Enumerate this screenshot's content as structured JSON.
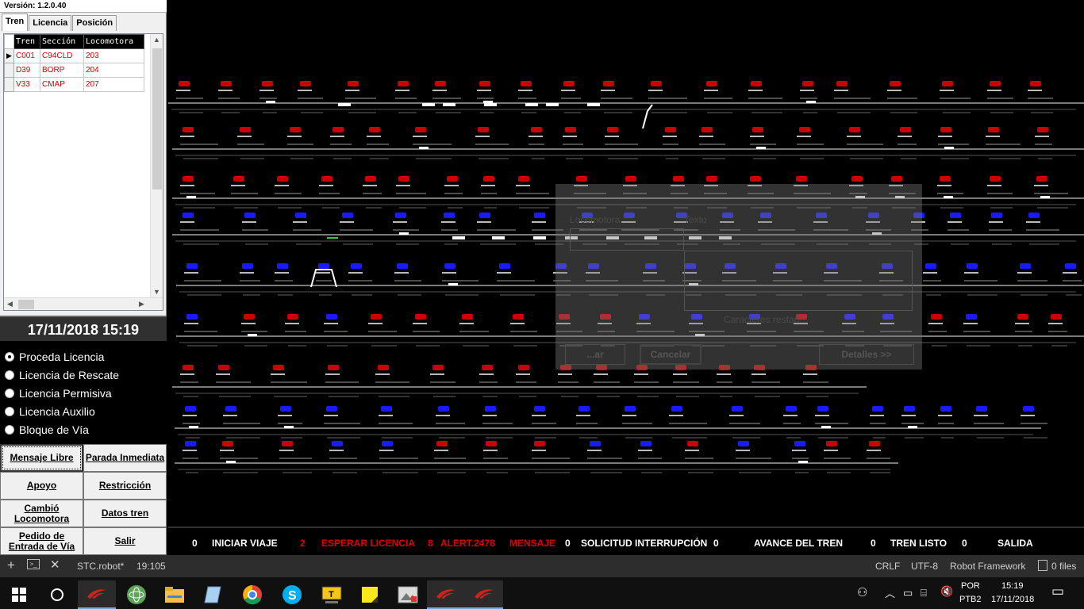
{
  "version": "Versión: 1.2.0.40",
  "tabs": [
    "Tren",
    "Licencia",
    "Posición"
  ],
  "grid": {
    "headers": [
      "Tren",
      "Sección",
      "Locomotora"
    ],
    "rows": [
      [
        "C001",
        "C94CLD",
        "203"
      ],
      [
        "D39",
        "BORP",
        "204"
      ],
      [
        "V33",
        "CMAP",
        "207"
      ]
    ]
  },
  "clock": "17/11/2018 15:19",
  "licenses": [
    {
      "label": "Proceda Licencia",
      "selected": true
    },
    {
      "label": "Licencia de Rescate",
      "selected": false
    },
    {
      "label": "Licencia Permisiva",
      "selected": false
    },
    {
      "label": "Licencia Auxilio",
      "selected": false
    },
    {
      "label": "Bloque de Vía",
      "selected": false
    }
  ],
  "buttons": [
    "Mensaje Libre",
    "Parada Inmediata",
    "Apoyo",
    "Restricción",
    "Cambió Locomotora",
    "Datos tren",
    "Pedido de Entrada de Vía",
    "Salir"
  ],
  "dialog": {
    "locomotora_label": "Locomotora",
    "texto_label": "Texto",
    "chars_label": "Caracteres restan...",
    "cancel_label": "Cancelar",
    "details_label": "Detalles >>",
    "ok_label": "...ar"
  },
  "status": {
    "iniciar_count": "0",
    "iniciar_label": "INICIAR VIAJE",
    "esperar_count": "2",
    "esperar_label": "ESPERAR LICENCIA",
    "alert_count": "8",
    "alert_label": "ALERT.2478",
    "mensaje_label": "MENSAJE",
    "solicitud_count": "0",
    "solicitud_label": "SOLICITUD INTERRUPCIÓN",
    "avance_count": "0",
    "avance_label": "AVANCE DEL TREN",
    "listo_count": "0",
    "listo_label": "TREN LISTO",
    "salida_count": "0",
    "salida_label": "SALIDA"
  },
  "editor": {
    "file": "STC.robot*",
    "cursor": "19:105",
    "eol": "CRLF",
    "encoding": "UTF-8",
    "language": "Robot Framework",
    "files": "0 files"
  },
  "taskbar": {
    "lang": "POR",
    "layout": "PTB2",
    "time": "15:19",
    "date": "17/11/2018"
  },
  "colors": {
    "red_station": "#cc0000",
    "blue_station": "#1a1aff",
    "track": "#7a7a7a",
    "occupied": "#ffffff"
  }
}
